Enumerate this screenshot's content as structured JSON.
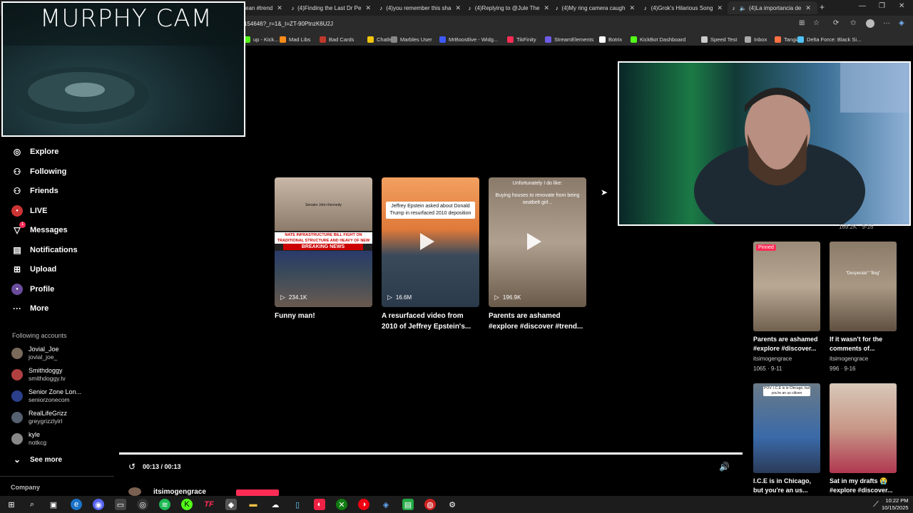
{
  "browser": {
    "tabs": [
      {
        "title": "ean #trend"
      },
      {
        "title": "(4)Finding the Last Dr Pe"
      },
      {
        "title": "(4)you remember this sha"
      },
      {
        "title": "(4)Replying to @Jule The"
      },
      {
        "title": "(4)My ring camera caugh"
      },
      {
        "title": "(4)Grok's Hilarious Song"
      },
      {
        "title": "(4)La importancia de"
      }
    ],
    "new_tab": "+",
    "address": "154646?_r=1&_t=ZT-90PtnzK6U2J",
    "bookmarks": [
      {
        "label": "up - Kick...",
        "color": "#53fc18"
      },
      {
        "label": "Mad Libs",
        "color": "#ff8c1a"
      },
      {
        "label": "Bad Cards",
        "color": "#c0392b"
      },
      {
        "label": "Chatle",
        "color": "#f1c40f"
      },
      {
        "label": "Marbles User",
        "color": "#888888"
      },
      {
        "label": "MrBoostlive - Widg...",
        "color": "#3d5afe"
      },
      {
        "label": "TikFinity",
        "color": "#fe2c55"
      },
      {
        "label": "StreamElements",
        "color": "#6c5ce7"
      },
      {
        "label": "Botrix",
        "color": "#ffffff"
      },
      {
        "label": "KickBot Dashboard",
        "color": "#53fc18"
      },
      {
        "label": "Speed Test",
        "color": "#cccccc"
      },
      {
        "label": "Inbox",
        "color": "#aaaaaa"
      },
      {
        "label": "Tangia",
        "color": "#ff7043"
      },
      {
        "label": "Delta Force: Black Si...",
        "color": "#4fc3f7"
      }
    ]
  },
  "overlay": {
    "cam_title": "MURPHY CAM"
  },
  "sidebar": {
    "nav": [
      {
        "label": "Explore",
        "icon": "compass-icon",
        "glyph": "◎"
      },
      {
        "label": "Following",
        "icon": "following-user-icon",
        "glyph": "⚇"
      },
      {
        "label": "Friends",
        "icon": "friends-icon",
        "glyph": "⚇"
      },
      {
        "label": "LIVE",
        "icon": "live-avatar-icon",
        "glyph": "●"
      },
      {
        "label": "Messages",
        "icon": "message-icon",
        "glyph": "▽"
      },
      {
        "label": "Notifications",
        "icon": "notification-icon",
        "glyph": "▤"
      },
      {
        "label": "Upload",
        "icon": "upload-icon",
        "glyph": "⊞"
      },
      {
        "label": "Profile",
        "icon": "profile-icon",
        "glyph": "●"
      },
      {
        "label": "More",
        "icon": "more-icon",
        "glyph": "···"
      }
    ],
    "messages_badge": "1",
    "following_title": "Following accounts",
    "accounts": [
      {
        "name": "Jovial_Joe",
        "handle": "jovial_joe_",
        "color": "#7a6a5a"
      },
      {
        "name": "Smithdoggy",
        "handle": "smithdoggy.tv",
        "color": "#b04040"
      },
      {
        "name": "Senior Zone Lon...",
        "handle": "seniorzonecom",
        "color": "#2b3f8a"
      },
      {
        "name": "RealLifeGrizz",
        "handle": "greygrizzlyirl",
        "color": "#556070"
      },
      {
        "name": "kyle",
        "handle": "notkcg",
        "color": "#888888"
      }
    ],
    "see_more": "See more",
    "company": "Company"
  },
  "videos": [
    {
      "title_line1": "Funny man!",
      "title_line2": "",
      "views": "234.1K",
      "caption": "NATE INFRASTRUCTURE BILL FIGHT ON TRADITIONAL STRUCTURE AND HEAVY OF NEW DEAL SOCIALISM",
      "breaking": "BREAKING NEWS",
      "name_tag": "Senator John Kennedy"
    },
    {
      "title_line1": "A resurfaced video from",
      "title_line2": "2010 of Jeffrey Epstein's...",
      "views": "16.6M",
      "caption": "Jeffrey Epstein asked about Donald Trump in resurfaced 2010 deposition"
    },
    {
      "title_line1": "Parents are ashamed",
      "title_line2": "#explore #discover #trend...",
      "views": "196.9K",
      "caption_top": "Unfortunately I do like:",
      "caption": "Buying houses to renovate from being seatbelt girl..."
    }
  ],
  "right_grid": {
    "top_meta": "169.2K · 9-16",
    "items": [
      {
        "title_line1": "Parents are ashamed",
        "title_line2": "#explore #discover...",
        "author": "itsimogengrace",
        "meta": "1065 · 9-11",
        "pinned": "Pinned"
      },
      {
        "title_line1": "If it wasn't for the",
        "title_line2": "comments of...",
        "author": "itsimogengrace",
        "meta": "996 · 9-16",
        "caption": "\"Desperate\" \"Beg\""
      },
      {
        "title_line1": "I.C.E is in Chicago,",
        "title_line2": "but you're an us...",
        "author": "",
        "meta": "",
        "caption": "POV: I.C.E is in Chicago, but you're an us citizen"
      },
      {
        "title_line1": "Sat in my drafts 😭",
        "title_line2": "#explore #discover...",
        "author": "",
        "meta": ""
      }
    ]
  },
  "player": {
    "time": "00:13 / 00:13",
    "author_partial": "itsimogengrace"
  },
  "taskbar": {
    "time": "10:22 PM",
    "date": "10/15/2025"
  },
  "colors": {
    "accent": "#fe2c55",
    "background": "#000000"
  }
}
